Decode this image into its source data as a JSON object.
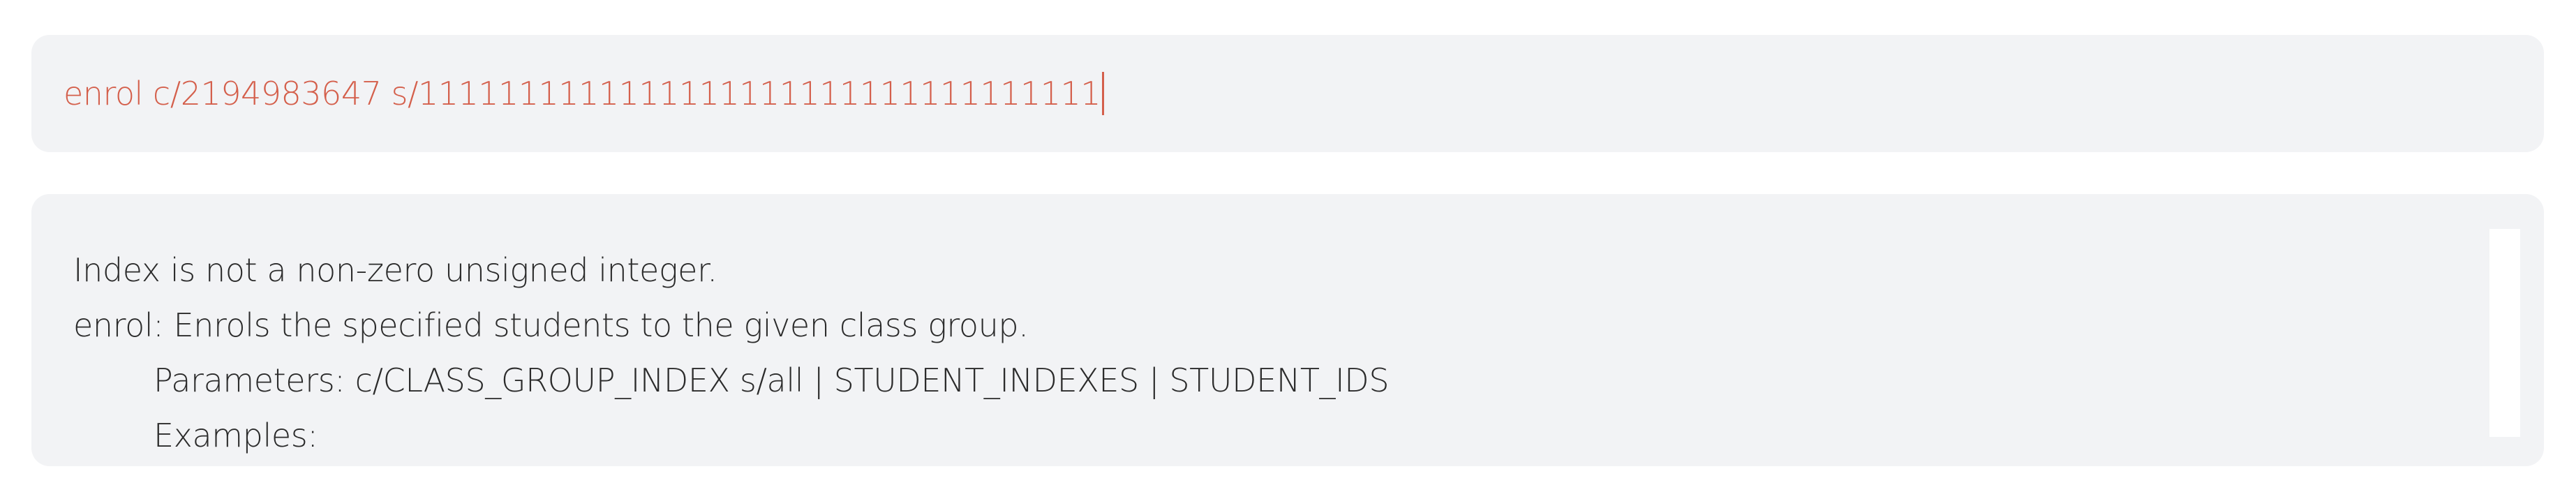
{
  "command": {
    "value": "enrol c/2194983647 s/1111111111111111111111111111111111"
  },
  "result": {
    "lines": [
      "Index is not a non-zero unsigned integer.",
      "enrol: Enrols the specified students to the given class group.",
      "Parameters: c/CLASS_GROUP_INDEX s/all | STUDENT_INDEXES | STUDENT_IDS",
      "Examples:"
    ]
  },
  "colors": {
    "error_text": "#d45f4b",
    "panel_bg": "#f2f3f5",
    "body_text": "#2b2b2b"
  }
}
